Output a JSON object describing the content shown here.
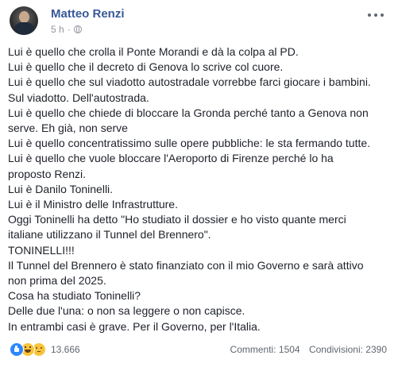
{
  "post": {
    "author": "Matteo Renzi",
    "time": "5 h",
    "separator": "·",
    "privacy_icon": "globe-icon",
    "options_icon": "more-icon",
    "lines": [
      "Lui è quello che crolla il Ponte Morandi e dà la colpa al PD.",
      "Lui è quello che il decreto di Genova lo scrive col cuore.",
      "Lui è quello che sul viadotto autostradale vorrebbe farci giocare i bambini.",
      "Sul viadotto. Dell'autostrada.",
      "Lui è quello che chiede di bloccare la Gronda perché tanto a Genova non",
      "serve. Eh già, non serve",
      "Lui è quello concentratissimo sulle opere pubbliche: le sta fermando tutte.",
      "Lui è quello che vuole bloccare l'Aeroporto di Firenze perché lo ha",
      "proposto Renzi.",
      "Lui è Danilo Toninelli.",
      "Lui è il Ministro delle Infrastrutture.",
      "Oggi Toninelli ha detto \"Ho studiato il dossier e ho visto quante merci",
      "italiane utilizzano il Tunnel del Brennero\".",
      "TONINELLI!!!",
      "Il Tunnel del Brennero è stato finanziato con il mio Governo e sarà attivo",
      "non prima del 2025.",
      "Cosa ha studiato Toninelli?",
      "Delle due l'una: o non sa leggere o non capisce.",
      "In entrambi casi è grave. Per il Governo, per l'Italia."
    ]
  },
  "footer": {
    "reaction_icons": [
      "like-reaction-icon",
      "haha-reaction-icon",
      "sad-reaction-icon"
    ],
    "reaction_count": "13.666",
    "comments": "Commenti: 1504",
    "shares": "Condivisioni: 2390"
  },
  "colors": {
    "author": "#385898",
    "text": "#1d2129",
    "meta": "#90949c",
    "like": "#2d88ff",
    "emoji": "#f7c43b"
  }
}
